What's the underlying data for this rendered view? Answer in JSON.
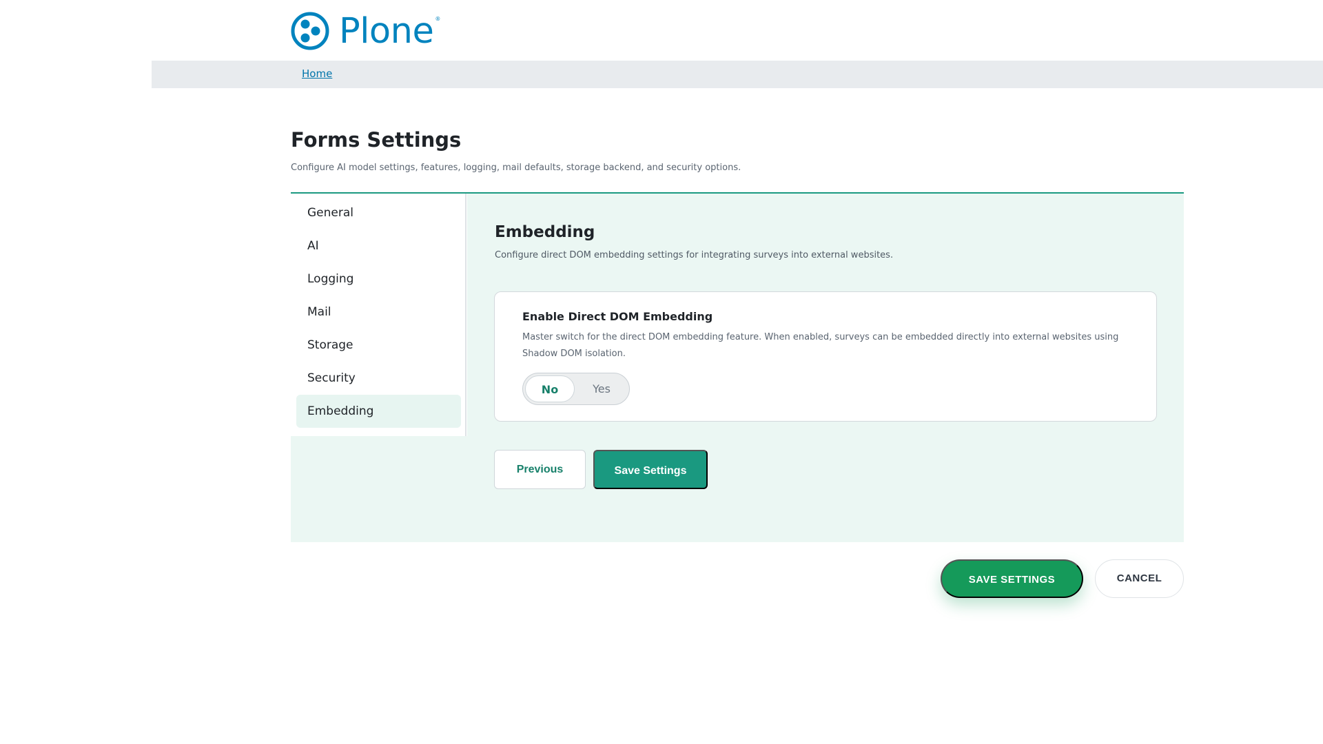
{
  "header": {
    "logo_text": "Plone",
    "logo_reg": "®",
    "brand_color": "#0083be"
  },
  "breadcrumb": {
    "home_label": "Home"
  },
  "page": {
    "title": "Forms Settings",
    "description": "Configure AI model settings, features, logging, mail defaults, storage backend, and security options."
  },
  "sidebar": {
    "items": [
      {
        "label": "General",
        "active": false
      },
      {
        "label": "AI",
        "active": false
      },
      {
        "label": "Logging",
        "active": false
      },
      {
        "label": "Mail",
        "active": false
      },
      {
        "label": "Storage",
        "active": false
      },
      {
        "label": "Security",
        "active": false
      },
      {
        "label": "Embedding",
        "active": true
      }
    ]
  },
  "section": {
    "title": "Embedding",
    "description": "Configure direct DOM embedding settings for integrating surveys into external websites.",
    "field": {
      "label": "Enable Direct DOM Embedding",
      "help": "Master switch for the direct DOM embedding feature. When enabled, surveys can be embedded directly into external websites using Shadow DOM isolation.",
      "options": [
        "No",
        "Yes"
      ],
      "selected": "No"
    },
    "previous_label": "Previous",
    "save_label": "Save Settings"
  },
  "actions": {
    "save_label": "SAVE SETTINGS",
    "cancel_label": "CANCEL"
  },
  "colors": {
    "accent": "#1a9980",
    "save_main": "#159a5a",
    "panel_bg": "#ebf7f3"
  }
}
